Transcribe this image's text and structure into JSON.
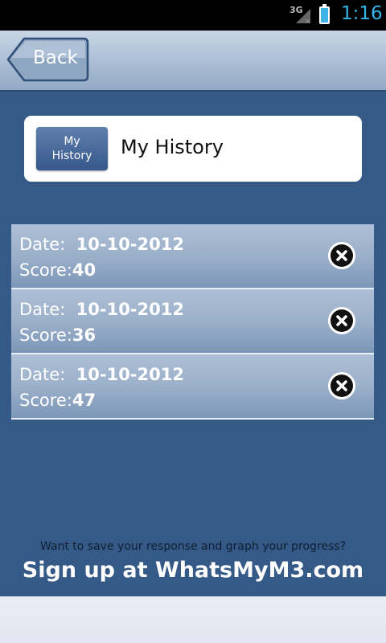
{
  "status_bar": {
    "network": "3G",
    "time": "1:16"
  },
  "header": {
    "back_label": "Back"
  },
  "title_card": {
    "badge_line1": "My",
    "badge_line2": "History",
    "title": "My History"
  },
  "history": {
    "date_label": "Date:",
    "score_label": "Score:",
    "items": [
      {
        "date": "10-10-2012",
        "score": "40"
      },
      {
        "date": "10-10-2012",
        "score": "36"
      },
      {
        "date": "10-10-2012",
        "score": "47"
      }
    ]
  },
  "promo": {
    "question": "Want to save your response and graph your progress?",
    "signup": "Sign up at WhatsMyM3.com"
  },
  "colors": {
    "background": "#355a87",
    "time": "#33b5e5"
  }
}
